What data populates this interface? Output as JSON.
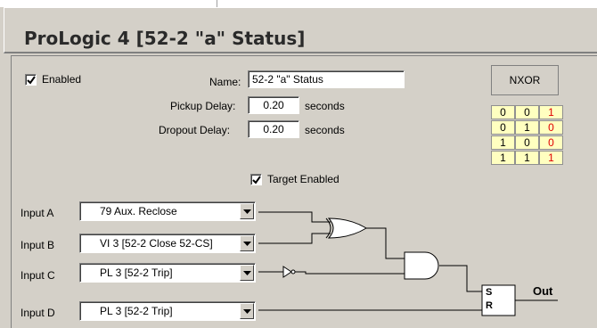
{
  "window": {
    "title": "ProLogic 4 [52-2 \"a\" Status]"
  },
  "form": {
    "enabled_label": "Enabled",
    "enabled_checked": true,
    "name_label": "Name:",
    "name_value": "52-2 \"a\" Status",
    "pickup_label": "Pickup Delay:",
    "pickup_value": "0.20",
    "pickup_unit": "seconds",
    "dropout_label": "Dropout Delay:",
    "dropout_value": "0.20",
    "dropout_unit": "seconds",
    "target_label": "Target Enabled",
    "target_checked": true
  },
  "truth_table": {
    "title": "NXOR",
    "rows": [
      [
        "0",
        "0",
        "1"
      ],
      [
        "0",
        "1",
        "0"
      ],
      [
        "1",
        "0",
        "0"
      ],
      [
        "1",
        "1",
        "1"
      ]
    ]
  },
  "inputs": [
    {
      "label": "Input A",
      "value": "79 Aux. Reclose"
    },
    {
      "label": "Input B",
      "value": "VI 3 [52-2 Close 52-CS]"
    },
    {
      "label": "Input C",
      "value": "PL 3 [52-2 Trip]"
    },
    {
      "label": "Input D",
      "value": "PL 3 [52-2 Trip]"
    }
  ],
  "logic": {
    "latch_set": "S",
    "latch_reset": "R",
    "output_label": "Out"
  }
}
